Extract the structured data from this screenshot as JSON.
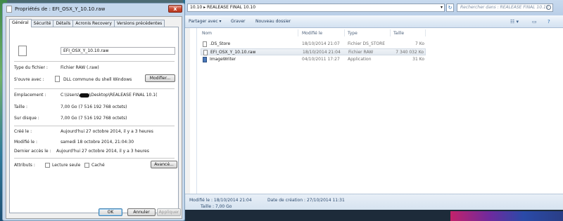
{
  "dialog": {
    "title": "Propriétés de : EFI_OSX_Y_10.10.raw",
    "close_glyph": "x",
    "tabs": [
      "Général",
      "Sécurité",
      "Détails",
      "Acronis Recovery",
      "Versions précédentes"
    ],
    "file_name": "EFI_OSX_Y_10.10.raw",
    "type_label": "Type du fichier :",
    "type_value": "Fichier RAW (.raw)",
    "opens_label": "S'ouvre avec :",
    "opens_value": "DLL commune du shell Windows",
    "modify_button": "Modifier...",
    "location_label": "Emplacement :",
    "location_value_prefix": "C:\\Users\\",
    "location_value_suffix": "\\Desktop\\REALEASE FINAL 10.1(",
    "size_label": "Taille :",
    "size_value": "7,00 Go (7 516 192 768 octets)",
    "disk_label": "Sur disque :",
    "disk_value": "7,00 Go (7 516 192 768 octets)",
    "created_label": "Créé le :",
    "created_value": "Aujourd'hui 27 octobre 2014, il y a 3 heures",
    "modified_label": "Modifié le :",
    "modified_value": "samedi 18 octobre 2014, 21:04:30",
    "accessed_label": "Dernier accès le :",
    "accessed_value": "Aujourd'hui 27 octobre 2014, il y a 3 heures",
    "attributes_label": "Attributs :",
    "readonly_label": "Lecture seule",
    "hidden_label": "Caché",
    "advanced_button": "Avancé...",
    "ok_button": "OK",
    "cancel_button": "Annuler",
    "apply_button": "Appliquer"
  },
  "explorer": {
    "breadcrumb": "10.10 ▸ REALEASE FINAL 10.10",
    "search_placeholder": "Rechercher dans : REALEASE FINAL 10.10",
    "toolbar": {
      "share_label": "Partager avec ▾",
      "burn_label": "Graver",
      "new_folder_label": "Nouveau dossier"
    },
    "columns": [
      "Nom",
      "Modifié le",
      "Type",
      "Taille"
    ],
    "files": [
      {
        "name": ".DS_Store",
        "modified": "18/10/2014 21:07",
        "type": "Fichier DS_STORE",
        "size": "7 Ko"
      },
      {
        "name": "EFI_OSX_Y_10.10.raw",
        "modified": "18/10/2014 21:04",
        "type": "Fichier RAW",
        "size": "7 340 032 Ko"
      },
      {
        "name": "ImageWriter",
        "modified": "04/10/2011 17:27",
        "type": "Application",
        "size": "31 Ko"
      }
    ],
    "status": {
      "modified_label": "Modifié le : 18/10/2014 21:04",
      "created_label": "Date de création : 27/10/2014 11:31",
      "size_label": "Taille : 7,00 Go"
    }
  }
}
